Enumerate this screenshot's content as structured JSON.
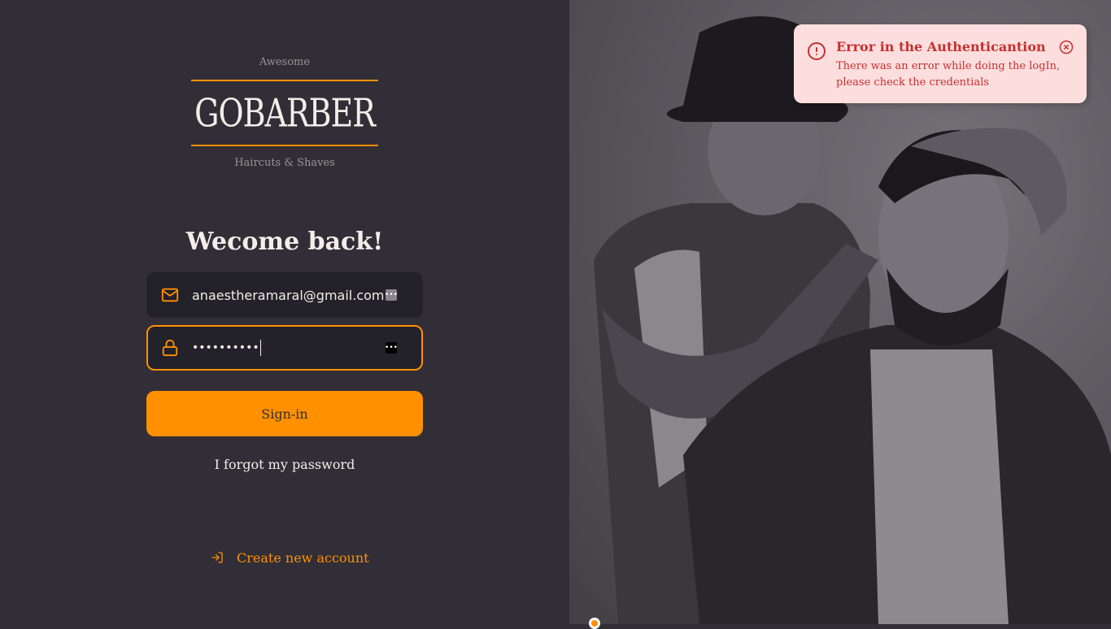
{
  "logo": {
    "top_text": "Awesome",
    "brand": "GOBARBER",
    "bottom_text": "Haircuts & Shaves"
  },
  "form": {
    "title": "Wecome back!",
    "email_value": "anaestheramaral@gmail.com",
    "password_value": "••••••••••",
    "submit_label": "Sign-in",
    "forgot_label": "I forgot my password"
  },
  "create_account": {
    "label": "Create new account"
  },
  "toast": {
    "title": "Error in the Authenticantion",
    "description": "There was an error while doing the logIn, please check the credentials"
  },
  "icons": {
    "email": "mail-icon",
    "password": "lock-icon",
    "create": "log-in-icon",
    "toast": "alert-circle-icon",
    "close": "x-circle-icon"
  },
  "colors": {
    "background": "#312e38",
    "input_bg": "#232129",
    "accent": "#ff9000",
    "text": "#f4ede8",
    "muted": "#999591",
    "error_bg": "#fddede",
    "error_text": "#c53030"
  }
}
